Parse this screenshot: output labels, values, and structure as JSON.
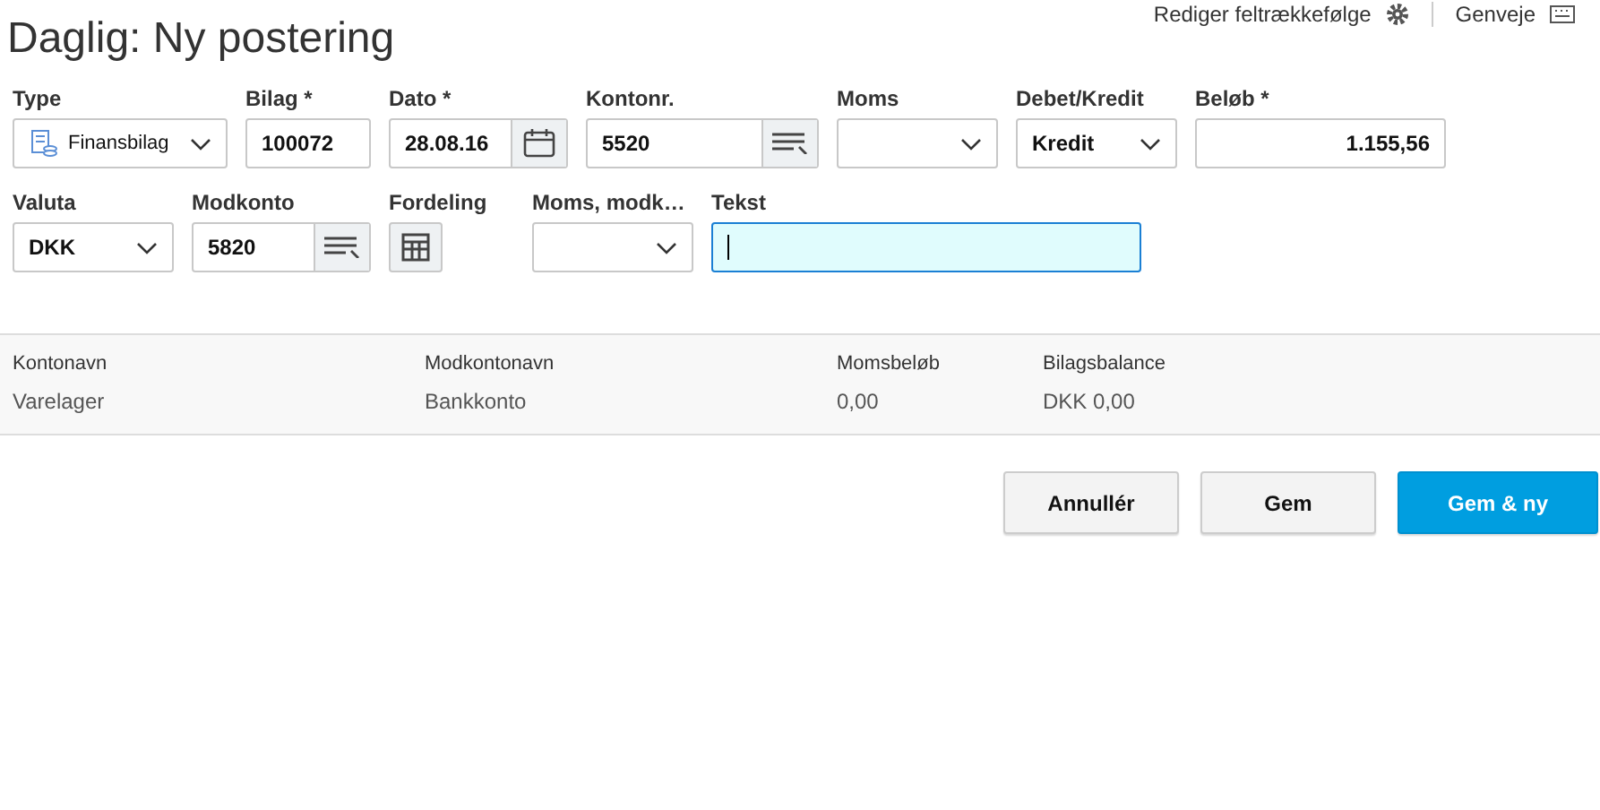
{
  "header": {
    "title": "Daglig: Ny postering",
    "links": [
      "Rediger feltrækkefølge",
      "Genveje"
    ]
  },
  "rows": [
    [
      {
        "label": "Type",
        "kind": "select",
        "value": "Finansbilag",
        "icon": true
      },
      {
        "label": "Bilag *",
        "kind": "input",
        "value": "100072"
      },
      {
        "label": "Dato *",
        "kind": "date",
        "value": "28.08.16"
      },
      {
        "label": "Kontonr.",
        "kind": "lookup",
        "value": "5520"
      },
      {
        "label": "Moms",
        "kind": "select"
      },
      {
        "label": "Debet/Kredit",
        "kind": "select",
        "value": "Kredit"
      },
      {
        "label": "Beløb *",
        "kind": "amount",
        "value": "1.155,56"
      }
    ],
    [
      {
        "label": "Valuta",
        "kind": "select",
        "value": "DKK"
      },
      {
        "label": "Modkonto",
        "kind": "lookup",
        "value": "5820"
      },
      {
        "label": "Fordeling",
        "kind": "grid"
      },
      {
        "label": "Moms, modk…",
        "kind": "select"
      },
      {
        "label": "Tekst",
        "kind": "text",
        "focused": true
      }
    ]
  ],
  "summary": [
    {
      "label": "Kontonavn",
      "value": "Varelager"
    },
    {
      "label": "Modkontonavn",
      "value": "Bankkonto"
    },
    {
      "label": "Momsbeløb",
      "value": "0,00"
    },
    {
      "label": "Bilagsbalance",
      "value": "DKK 0,00"
    }
  ],
  "buttons": [
    {
      "label": "Annullér",
      "primary": false
    },
    {
      "label": "Gem",
      "primary": false
    },
    {
      "label": "Gem & ny",
      "primary": true
    }
  ]
}
